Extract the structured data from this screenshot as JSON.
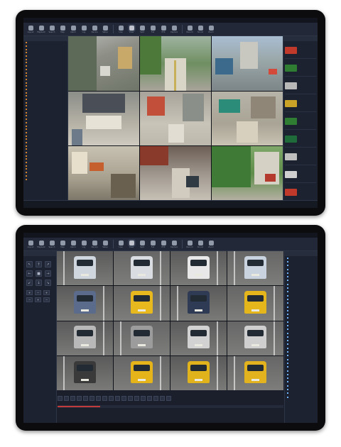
{
  "screen1": {
    "title": "",
    "toolbar": [
      {
        "label": "Layout",
        "icon": "layout-icon"
      },
      {
        "label": "Playback",
        "icon": "playback-icon"
      },
      {
        "label": "Search",
        "icon": "search-icon"
      },
      {
        "label": "Map",
        "icon": "map-icon"
      },
      {
        "label": "Alarm",
        "icon": "alarm-icon"
      },
      {
        "label": "Log",
        "icon": "log-icon"
      },
      {
        "label": "Device",
        "icon": "device-icon"
      },
      {
        "label": "Setup",
        "icon": "gear-icon"
      },
      {
        "label": "Live",
        "icon": "camera-icon"
      },
      {
        "label": "View",
        "icon": "grid-icon"
      },
      {
        "label": "Split",
        "icon": "split-icon"
      },
      {
        "label": "Full",
        "icon": "fullscreen-icon"
      },
      {
        "label": "PTZ",
        "icon": "ptz-icon"
      },
      {
        "label": "Capture",
        "icon": "capture-icon"
      },
      {
        "label": "Record",
        "icon": "record-icon"
      },
      {
        "label": "Sound",
        "icon": "sound-icon"
      },
      {
        "label": "Zoom",
        "icon": "zoom-icon"
      }
    ],
    "left_panel_header": "",
    "tree_items": [
      "",
      "",
      "",
      "",
      "",
      "",
      "",
      "",
      "",
      "",
      "",
      "",
      "",
      "",
      "",
      "",
      "",
      "",
      "",
      "",
      "",
      "",
      "",
      "",
      "",
      "",
      "",
      "",
      "",
      "",
      "",
      "",
      "",
      "",
      "",
      "",
      "",
      "",
      "",
      "",
      "",
      ""
    ],
    "right_panel_header": "",
    "thumbnails": [
      "",
      "",
      "",
      "",
      "",
      "",
      "",
      "",
      "",
      ""
    ],
    "cameras": [
      {
        "label": ""
      },
      {
        "label": ""
      },
      {
        "label": ""
      },
      {
        "label": ""
      },
      {
        "label": ""
      },
      {
        "label": ""
      },
      {
        "label": ""
      },
      {
        "label": ""
      },
      {
        "label": ""
      }
    ],
    "status": ""
  },
  "screen2": {
    "menu": [
      "",
      "",
      "",
      ""
    ],
    "toolbar": [
      {
        "label": "Layout",
        "icon": "layout-icon"
      },
      {
        "label": "Playback",
        "icon": "playback-icon"
      },
      {
        "label": "Search",
        "icon": "search-icon"
      },
      {
        "label": "Map",
        "icon": "map-icon"
      },
      {
        "label": "Alarm",
        "icon": "alarm-icon"
      },
      {
        "label": "Log",
        "icon": "log-icon"
      },
      {
        "label": "Device",
        "icon": "device-icon"
      },
      {
        "label": "Setup",
        "icon": "gear-icon"
      },
      {
        "label": "Live",
        "icon": "camera-icon"
      },
      {
        "label": "View",
        "icon": "grid-icon"
      },
      {
        "label": "Split",
        "icon": "split-icon"
      },
      {
        "label": "Full",
        "icon": "fullscreen-icon"
      },
      {
        "label": "PTZ",
        "icon": "ptz-icon"
      },
      {
        "label": "Capture",
        "icon": "capture-icon"
      },
      {
        "label": "Record",
        "icon": "record-icon"
      },
      {
        "label": "Sound",
        "icon": "sound-icon"
      },
      {
        "label": "Zoom",
        "icon": "zoom-icon"
      }
    ],
    "ptz_header": "",
    "ptz_buttons": [
      "↖",
      "↑",
      "↗",
      "←",
      "■",
      "→",
      "↙",
      "↓",
      "↘"
    ],
    "zoom_buttons": [
      "+",
      "−",
      "+",
      "−",
      "+",
      "−"
    ],
    "left_labels": [
      "",
      "",
      ""
    ],
    "right_panel_header": "",
    "events": [
      "",
      "",
      "",
      "",
      "",
      "",
      "",
      "",
      "",
      "",
      "",
      "",
      "",
      "",
      "",
      "",
      "",
      "",
      "",
      "",
      "",
      "",
      "",
      "",
      "",
      "",
      "",
      "",
      "",
      "",
      "",
      "",
      "",
      "",
      "",
      "",
      "",
      ""
    ],
    "cameras": [
      {
        "label": ""
      },
      {
        "label": ""
      },
      {
        "label": ""
      },
      {
        "label": ""
      },
      {
        "label": ""
      },
      {
        "label": ""
      },
      {
        "label": ""
      },
      {
        "label": ""
      },
      {
        "label": ""
      },
      {
        "label": ""
      },
      {
        "label": ""
      },
      {
        "label": ""
      },
      {
        "label": ""
      },
      {
        "label": ""
      },
      {
        "label": ""
      },
      {
        "label": ""
      }
    ],
    "playback_buttons": [
      "",
      "",
      "",
      "",
      "",
      "",
      "",
      "",
      "",
      "",
      "",
      "",
      "",
      "",
      "",
      "",
      "",
      ""
    ],
    "status": ""
  },
  "colors": {
    "frame": "#0c0c0e",
    "ui_bg": "#1a1f2b",
    "panel": "#1c2230",
    "toolbar": "#222837",
    "accent_orange": "#d4852a",
    "label_yellow": "#ffe46b"
  }
}
